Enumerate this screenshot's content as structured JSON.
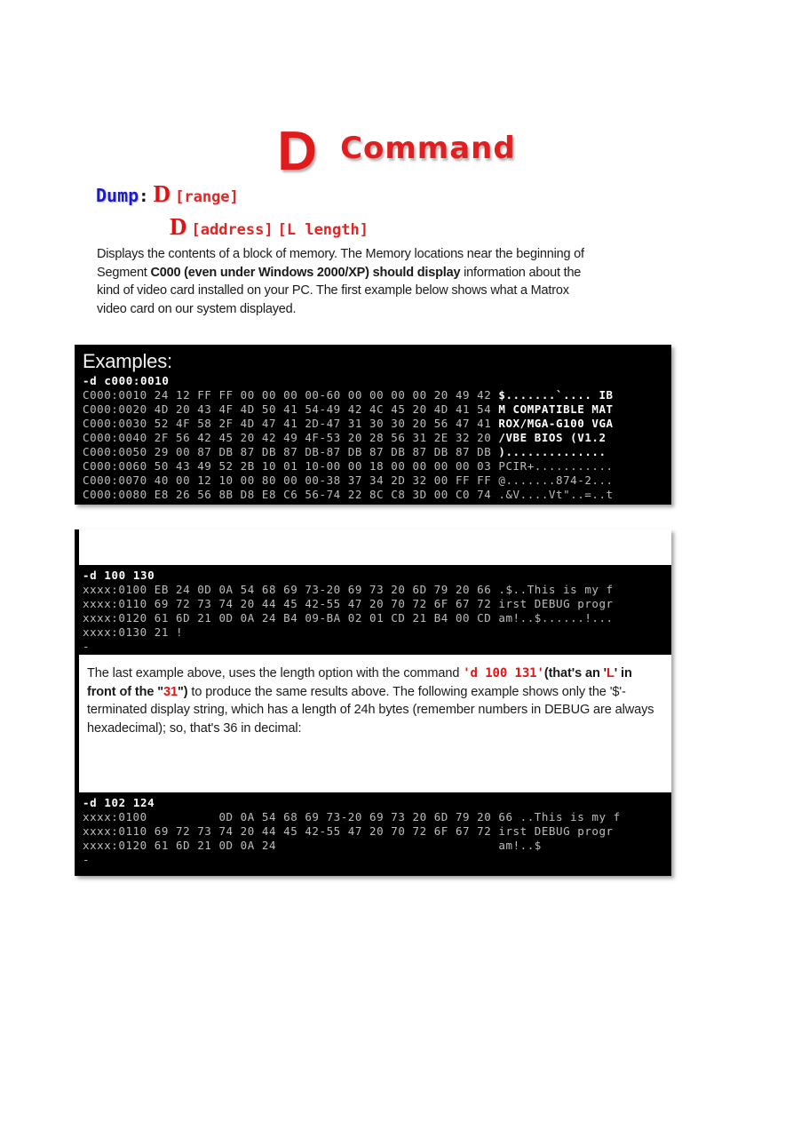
{
  "title": {
    "letter": "D",
    "word": "Command"
  },
  "syntax": {
    "line1": {
      "label": "Dump",
      "colon": ":",
      "cmd": "D",
      "arg": "[range]"
    },
    "line2": {
      "cmd": "D",
      "arg1": "[address]",
      "arg2": "[L length]"
    }
  },
  "intro": {
    "part1": "Displays the contents of a block of memory. The Memory locations near the beginning of Segment ",
    "bold1": "C000 (even under Windows 2000/XP) should display",
    "part2": " information about the kind of video card installed on your PC. The first example below shows what a Matrox video card on our system displayed."
  },
  "console1": {
    "heading": "Examples:",
    "command": "-d c000:0010",
    "lines": [
      {
        "addr": "C000:0010",
        "hex": "24 12 FF FF 00 00 00 00-60 00 00 00 00 20 49 42",
        "ascii": "$.......`.... IB",
        "bold": true
      },
      {
        "addr": "C000:0020",
        "hex": "4D 20 43 4F 4D 50 41 54-49 42 4C 45 20 4D 41 54",
        "ascii": "M COMPATIBLE MAT",
        "bold": true
      },
      {
        "addr": "C000:0030",
        "hex": "52 4F 58 2F 4D 47 41 2D-47 31 30 30 20 56 47 41",
        "ascii": "ROX/MGA-G100 VGA",
        "bold": true
      },
      {
        "addr": "C000:0040",
        "hex": "2F 56 42 45 20 42 49 4F-53 20 28 56 31 2E 32 20",
        "ascii": "/VBE BIOS (V1.2 ",
        "bold": true
      },
      {
        "addr": "C000:0050",
        "hex": "29 00 87 DB 87 DB 87 DB-87 DB 87 DB 87 DB 87 DB",
        "ascii": ")..............",
        "bold": true
      },
      {
        "addr": "C000:0060",
        "hex": "50 43 49 52 2B 10 01 10-00 00 18 00 00 00 00 03",
        "ascii": "PCIR+...........",
        "bold": false
      },
      {
        "addr": "C000:0070",
        "hex": "40 00 12 10 00 80 00 00-38 37 34 2D 32 00 FF FF",
        "ascii": "@.......874-2...",
        "bold": false
      },
      {
        "addr": "C000:0080",
        "hex": "E8 26 56 8B D8 E8 C6 56-74 22 8C C8 3D 00 C0 74",
        "ascii": ".&V....Vt\"..=..t",
        "bold": false
      }
    ]
  },
  "console2": {
    "command": "-d 100 130",
    "lines": [
      {
        "addr": "xxxx:0100",
        "hex": "EB 24 0D 0A 54 68 69 73-20 69 73 20 6D 79 20 66",
        "ascii": ".$..This is my f"
      },
      {
        "addr": "xxxx:0110",
        "hex": "69 72 73 74 20 44 45 42-55 47 20 70 72 6F 67 72",
        "ascii": "irst DEBUG progr"
      },
      {
        "addr": "xxxx:0120",
        "hex": "61 6D 21 0D 0A 24 B4 09-BA 02 01 CD 21 B4 00 CD",
        "ascii": "am!..$......!..."
      },
      {
        "addr": "xxxx:0130",
        "hex": "21",
        "ascii": "!"
      }
    ],
    "prompt": "-"
  },
  "midtext": {
    "p1": "The last example above, uses the length option with the command ",
    "cmd": "'d 100 131'",
    "b1": "(that's an '",
    "bL": "L",
    "b2": "' in front of the \"",
    "b31": "31",
    "b3": "\")",
    "p2": " to produce the same results above. The following example shows only the '$'-terminated display string, which has a length of 24h bytes (remember numbers in DEBUG are always hexadecimal); so, that's 36 in decimal:"
  },
  "console3": {
    "command": "-d 102 124",
    "lines": [
      {
        "addr": "xxxx:0100",
        "hex": "         0D 0A 54 68 69 73-20 69 73 20 6D 79 20 66",
        "ascii": "..This is my f"
      },
      {
        "addr": "xxxx:0110",
        "hex": "69 72 73 74 20 44 45 42-55 47 20 70 72 6F 67 72",
        "ascii": "irst DEBUG progr"
      },
      {
        "addr": "xxxx:0120",
        "hex": "61 6D 21 0D 0A 24",
        "ascii": "am!..$",
        "ascii_pad": true
      }
    ],
    "prompt": "-"
  },
  "colors": {
    "accent_red": "#e01b1b",
    "accent_blue": "#1a1ad0",
    "console_bg": "#000000",
    "console_fg": "#bdbdbd"
  }
}
